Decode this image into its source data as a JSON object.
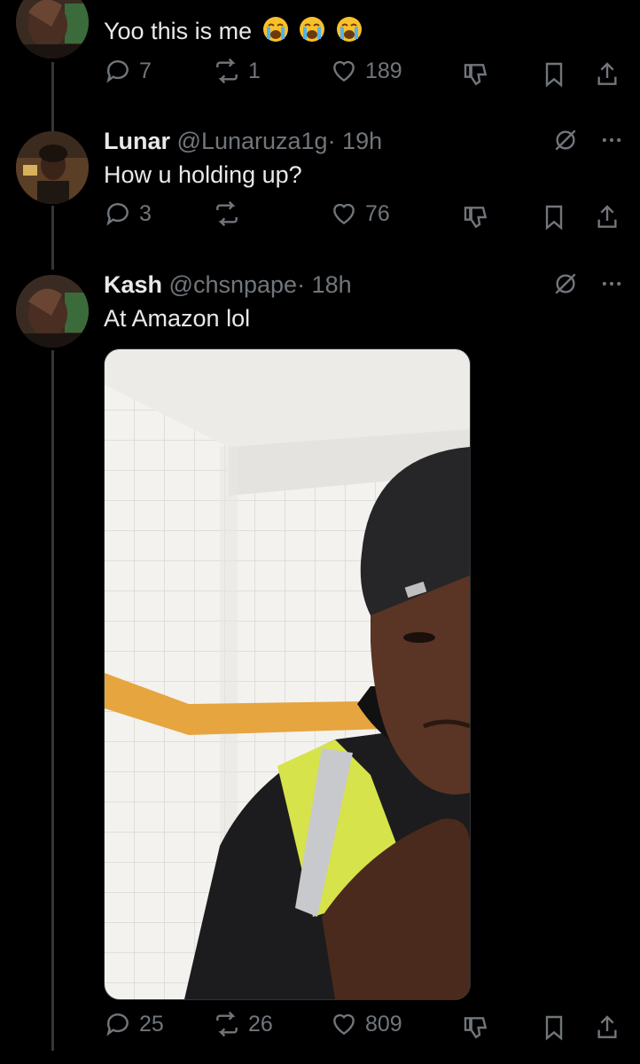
{
  "thread": [
    {
      "text": "Yoo this is me",
      "emoji_count": 3,
      "replies": "7",
      "reposts": "1",
      "likes": "189"
    },
    {
      "name": "Lunar",
      "handle": "@Lunaruza1g",
      "time": "· 19h",
      "text": "How u holding up?",
      "replies": "3",
      "reposts": "",
      "likes": "76"
    },
    {
      "name": "Kash",
      "handle": "@chsnpape",
      "time": "· 18h",
      "text": "At Amazon lol",
      "replies": "25",
      "reposts": "26",
      "likes": "809"
    }
  ],
  "colors": {
    "background": "#000000",
    "text": "#e7e9ea",
    "muted": "#71767b",
    "thread_line": "#333639"
  }
}
